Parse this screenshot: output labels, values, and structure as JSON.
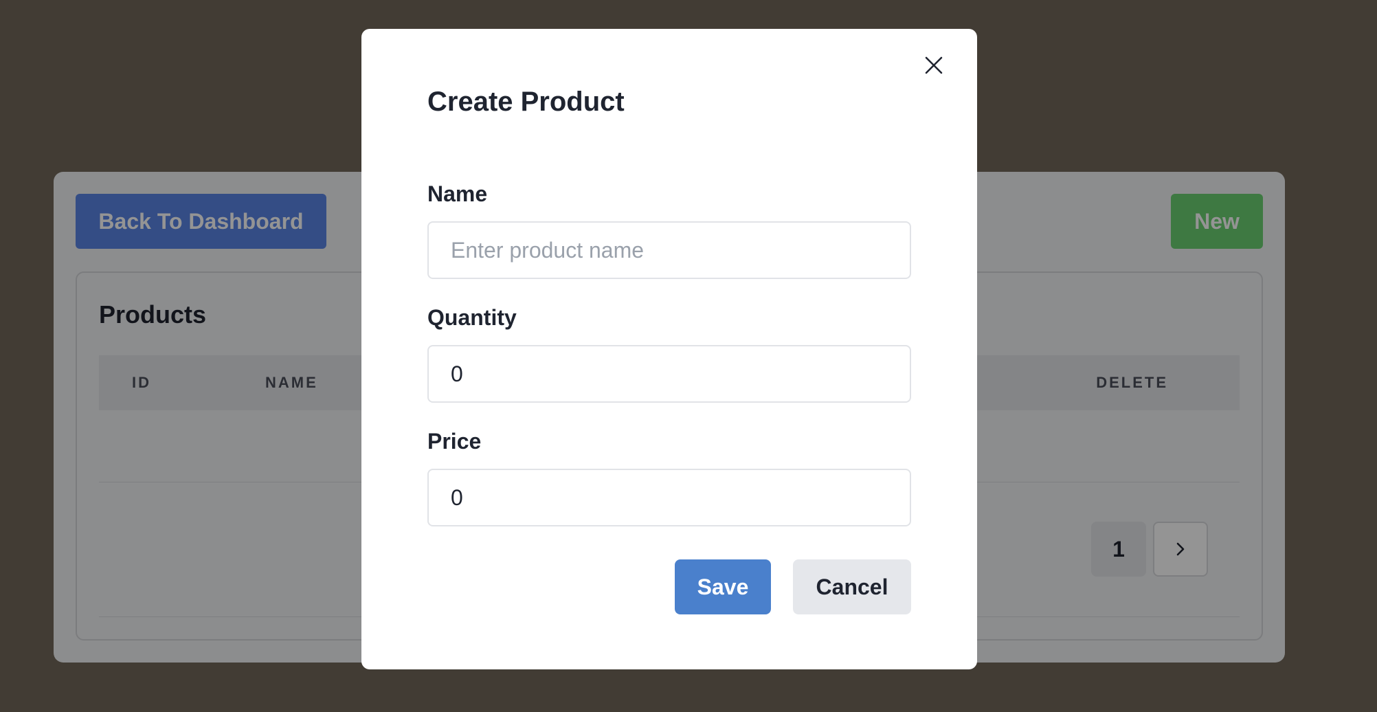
{
  "background_page": {
    "back_button_label": "Back To Dashboard",
    "new_button_label": "New",
    "panel_title": "Products",
    "table_columns": [
      "ID",
      "NAME",
      "DELETE"
    ],
    "pagination": {
      "current_page": "1",
      "next_icon": "chevron-right-icon"
    }
  },
  "modal": {
    "title": "Create Product",
    "close_icon": "close-icon",
    "fields": {
      "name": {
        "label": "Name",
        "value": "",
        "placeholder": "Enter product name"
      },
      "quantity": {
        "label": "Quantity",
        "value": "0"
      },
      "price": {
        "label": "Price",
        "value": "0"
      }
    },
    "save_label": "Save",
    "cancel_label": "Cancel"
  },
  "colors": {
    "backdrop": "#72685a",
    "primary": "#4a80cc",
    "back_button": "#5a86e6",
    "new_button": "#6cd072",
    "cancel_button": "#e5e7eb"
  }
}
